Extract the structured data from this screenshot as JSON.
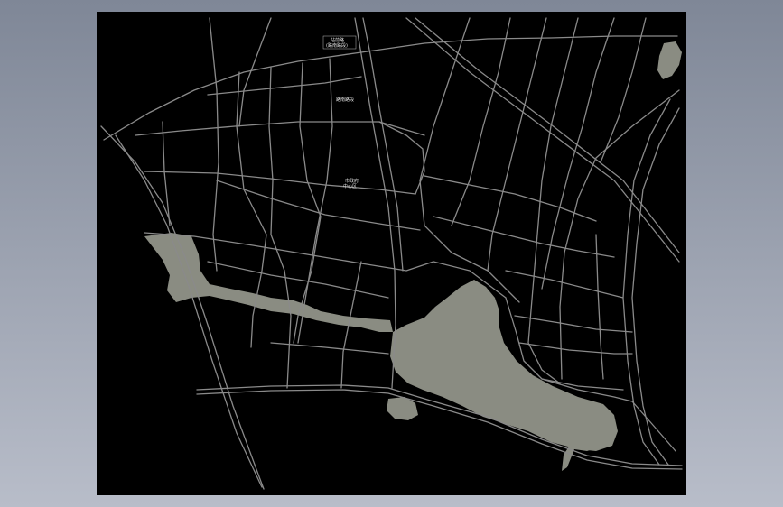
{
  "window": {
    "background_top": "#7f8797",
    "background_bottom": "#b8bdc9"
  },
  "map": {
    "canvas_color": "#000000",
    "road_color": "#8a8a8a",
    "water_color": "#8a8c82",
    "label_color": "#e6e6e6",
    "labels": {
      "top_label": "站前路",
      "top_sublabel": "(路南路段)",
      "mid_label": "路南路段",
      "center_label": "市政府",
      "center_sublabel": "中心区"
    }
  }
}
